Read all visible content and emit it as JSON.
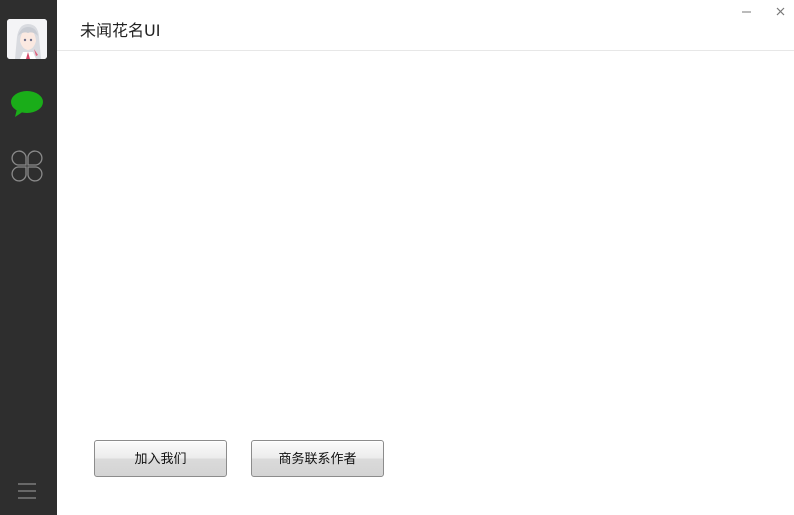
{
  "window": {
    "title": "未闻花名UI",
    "minimize_icon": "minimize-icon",
    "close_icon": "close-icon"
  },
  "sidebar": {
    "avatar_icon": "avatar",
    "items": [
      {
        "icon": "chat-bubble-icon",
        "active": true,
        "color": "#1aad19"
      },
      {
        "icon": "apps-clover-icon",
        "active": false,
        "color": "#9a9a9a"
      }
    ],
    "menu_icon": "hamburger-menu-icon",
    "background": "#2e2e2e"
  },
  "main": {
    "buttons": [
      {
        "label": "加入我们"
      },
      {
        "label": "商务联系作者"
      }
    ]
  }
}
